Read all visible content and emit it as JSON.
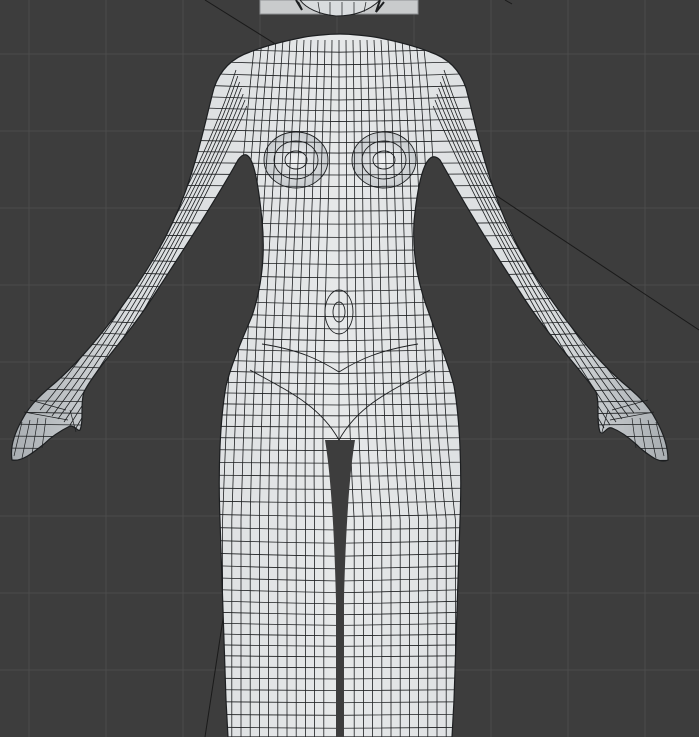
{
  "viewport": {
    "background": "#3d3d3d",
    "grid_color": "#4b4b4b",
    "axis_color": "#4f7fd6",
    "mesh_fill": "#d9dcde",
    "mesh_shadow": "#a9aeb2",
    "wire_color": "#1d1f21",
    "reference_plane_color": "#c9cbcc",
    "object": "character-mesh-front-view"
  }
}
